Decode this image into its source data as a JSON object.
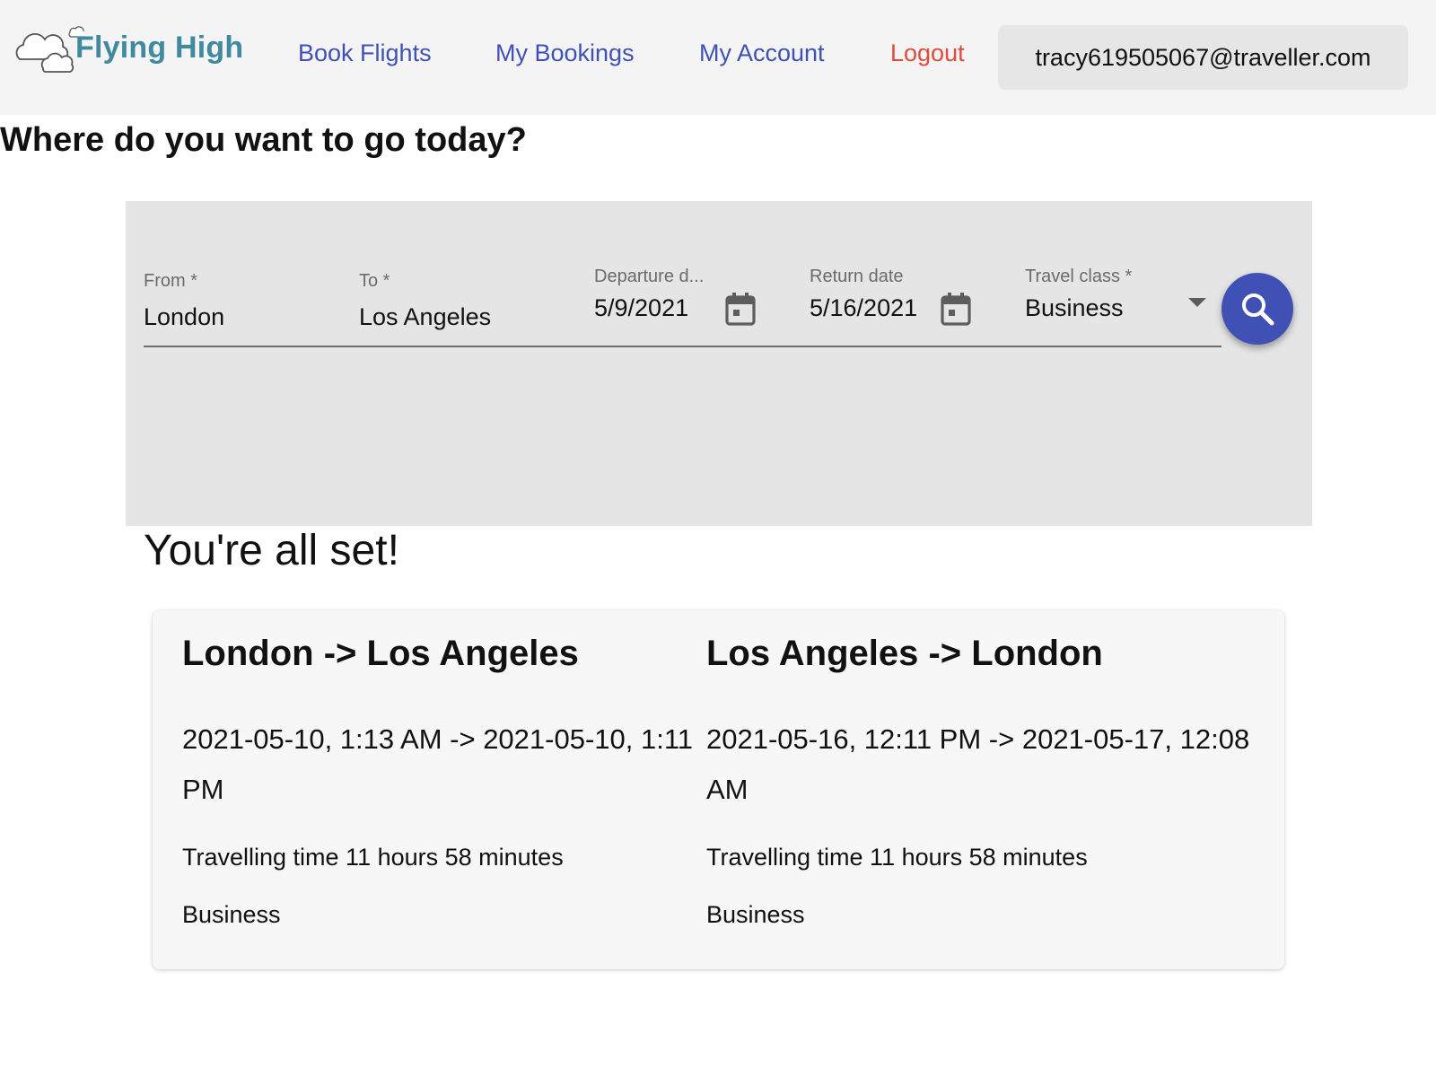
{
  "header": {
    "brand": "Flying High",
    "nav": {
      "book_flights": "Book Flights",
      "my_bookings": "My Bookings",
      "my_account": "My Account",
      "logout": "Logout"
    },
    "user_email": "tracy619505067@traveller.com"
  },
  "page": {
    "title": "Where do you want to go today?"
  },
  "search": {
    "from": {
      "label": "From *",
      "value": "London"
    },
    "to": {
      "label": "To *",
      "value": "Los Angeles"
    },
    "departure": {
      "label": "Departure d...",
      "value": "5/9/2021"
    },
    "return": {
      "label": "Return date",
      "value": "5/16/2021"
    },
    "travel_class": {
      "label": "Travel class *",
      "value": "Business"
    }
  },
  "confirmation": {
    "title": "You're all set!",
    "outbound": {
      "route": "London -> Los Angeles",
      "times": "2021-05-10, 1:13 AM -> 2021-05-10, 1:11 PM",
      "duration": "Travelling time 11 hours 58 minutes",
      "class": "Business"
    },
    "return": {
      "route": "Los Angeles -> London",
      "times": "2021-05-16, 12:11 PM -> 2021-05-17, 12:08 AM",
      "duration": "Travelling time 11 hours 58 minutes",
      "class": "Business"
    }
  },
  "colors": {
    "brand_teal": "#3f8a9e",
    "nav_blue": "#3f51b5",
    "logout_red": "#e24a3a",
    "header_bg": "#f4f4f4",
    "panel_bg": "#e5e5e5",
    "card_bg": "#f7f7f7"
  },
  "icons": {
    "logo": "cloud-icon",
    "date_picker": "calendar-icon",
    "select": "dropdown-arrow-icon",
    "search": "search-icon"
  }
}
